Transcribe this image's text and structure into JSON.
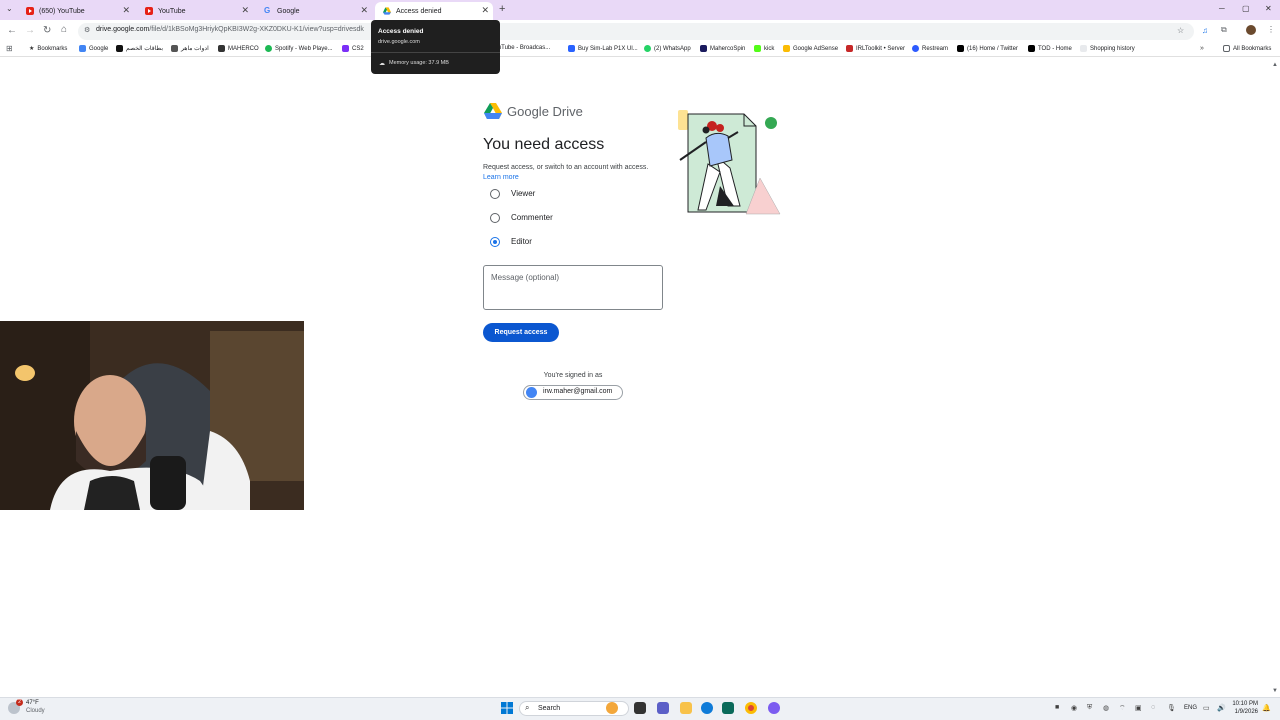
{
  "browser": {
    "tabs": [
      {
        "label": "(650) YouTube",
        "favicon": "youtube-icon"
      },
      {
        "label": "YouTube",
        "favicon": "youtube-icon"
      },
      {
        "label": "Google",
        "favicon": "google-icon"
      },
      {
        "label": "Access denied",
        "favicon": "google-drive-icon",
        "active": true
      }
    ],
    "new_tab": "+",
    "url_host": "drive.google.com",
    "url_path": "/file/d/1kBSoMg3HriykQpKBI3W2g-XKZ0DKU-K1/view?usp=drivesdk",
    "window_controls": {
      "minimize": "─",
      "maximize": "▢",
      "close": "✕"
    }
  },
  "bookmarks": [
    "Bookmarks",
    "Google",
    "بطاقات الخصم",
    "ادوات ماهر",
    "MAHERCO",
    "Spotify - Web Playe...",
    "CS2",
    "YouTube - Broadcas...",
    "Buy Sim-Lab P1X Ul...",
    "(2) WhatsApp",
    "MahercoSpin",
    "kick",
    "Google AdSense",
    "IRLToolkit • Server",
    "Restream",
    "(16) Home / Twitter",
    "TOD - Home",
    "Shopping history"
  ],
  "all_bookmarks": "All Bookmarks",
  "tooltip": {
    "title": "Access denied",
    "host": "drive.google.com",
    "memory": "Memory usage: 37.9 MB"
  },
  "page": {
    "product": "Google Drive",
    "heading": "You need access",
    "subtext": "Request access, or switch to an account with access.",
    "learn_more": "Learn more",
    "roles": [
      {
        "label": "Viewer",
        "checked": false
      },
      {
        "label": "Commenter",
        "checked": false
      },
      {
        "label": "Editor",
        "checked": true
      }
    ],
    "message_placeholder": "Message (optional)",
    "request_button": "Request access",
    "signed_in_label": "You're signed in as",
    "account_email": "irw.maher@gmail.com"
  },
  "taskbar": {
    "weather_temp": "47°F",
    "weather_desc": "Cloudy",
    "weather_badge": "2",
    "search": "Search",
    "language": "ENG",
    "time": "10:10 PM",
    "date": "1/9/2026"
  },
  "colors": {
    "tabstrip": "#e9d9f7",
    "accent_blue": "#0b57d0",
    "link_blue": "#1a73e8"
  }
}
